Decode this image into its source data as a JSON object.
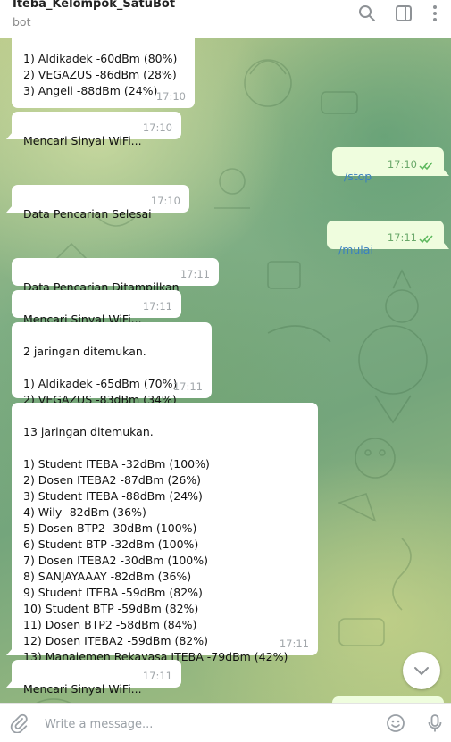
{
  "header": {
    "title": "Iteba_Kelompok_SatuBot",
    "subtitle": "bot"
  },
  "messages": [
    {
      "direction": "in",
      "text": "1) Aldikadek  -60dBm (80%)\n2) VEGAZUS  -86dBm (28%)\n3) Angeli  -88dBm (24%)",
      "time": "17:10"
    },
    {
      "direction": "in",
      "text": "Mencari Sinyal WiFi...",
      "time": "17:10"
    },
    {
      "direction": "out",
      "text": "/stop",
      "time": "17:10",
      "status": "read"
    },
    {
      "direction": "in",
      "text": "Data Pencarian Selesai",
      "time": "17:10"
    },
    {
      "direction": "out",
      "text": "/mulai",
      "time": "17:11",
      "status": "read"
    },
    {
      "direction": "in",
      "text": "Data Pencarian Ditampilkan",
      "time": "17:11"
    },
    {
      "direction": "in",
      "text": "Mencari Sinyal WiFi...",
      "time": "17:11"
    },
    {
      "direction": "in",
      "text": "2  jaringan ditemukan.\n\n1) Aldikadek  -65dBm (70%)\n2) VEGAZUS  -83dBm (34%)",
      "time": "17:11"
    },
    {
      "direction": "in",
      "text": "13  jaringan ditemukan.\n\n1) Student ITEBA  -32dBm (100%)\n2) Dosen ITEBA2  -87dBm (26%)\n3) Student ITEBA  -88dBm (24%)\n4) Wily  -82dBm (36%)\n5) Dosen BTP2  -30dBm (100%)\n6) Student BTP  -32dBm (100%)\n7) Dosen ITEBA2  -30dBm (100%)\n8) SANJAYAAAY  -82dBm (36%)\n9) Student ITEBA  -59dBm (82%)\n10) Student BTP  -59dBm (82%)\n11) Dosen BTP2  -58dBm (84%)\n12) Dosen ITEBA2  -59dBm (82%)\n13) Manajemen Rekayasa ITEBA  -79dBm (42%)",
      "time": "17:11"
    },
    {
      "direction": "in",
      "text": "Mencari Sinyal WiFi...",
      "time": "17:11"
    }
  ],
  "composer": {
    "placeholder": "Write a message..."
  },
  "icons": {
    "header": [
      "search-icon",
      "sidebar-toggle-icon",
      "more-vertical-icon"
    ],
    "footer": [
      "attach-icon",
      "emoji-icon",
      "microphone-icon"
    ],
    "scroll": "chevron-down-icon"
  },
  "colors": {
    "incoming_bubble": "#ffffff",
    "outgoing_bubble": "#effdde",
    "outgoing_text": "#3a80c0",
    "read_ticks": "#5cb85c"
  }
}
